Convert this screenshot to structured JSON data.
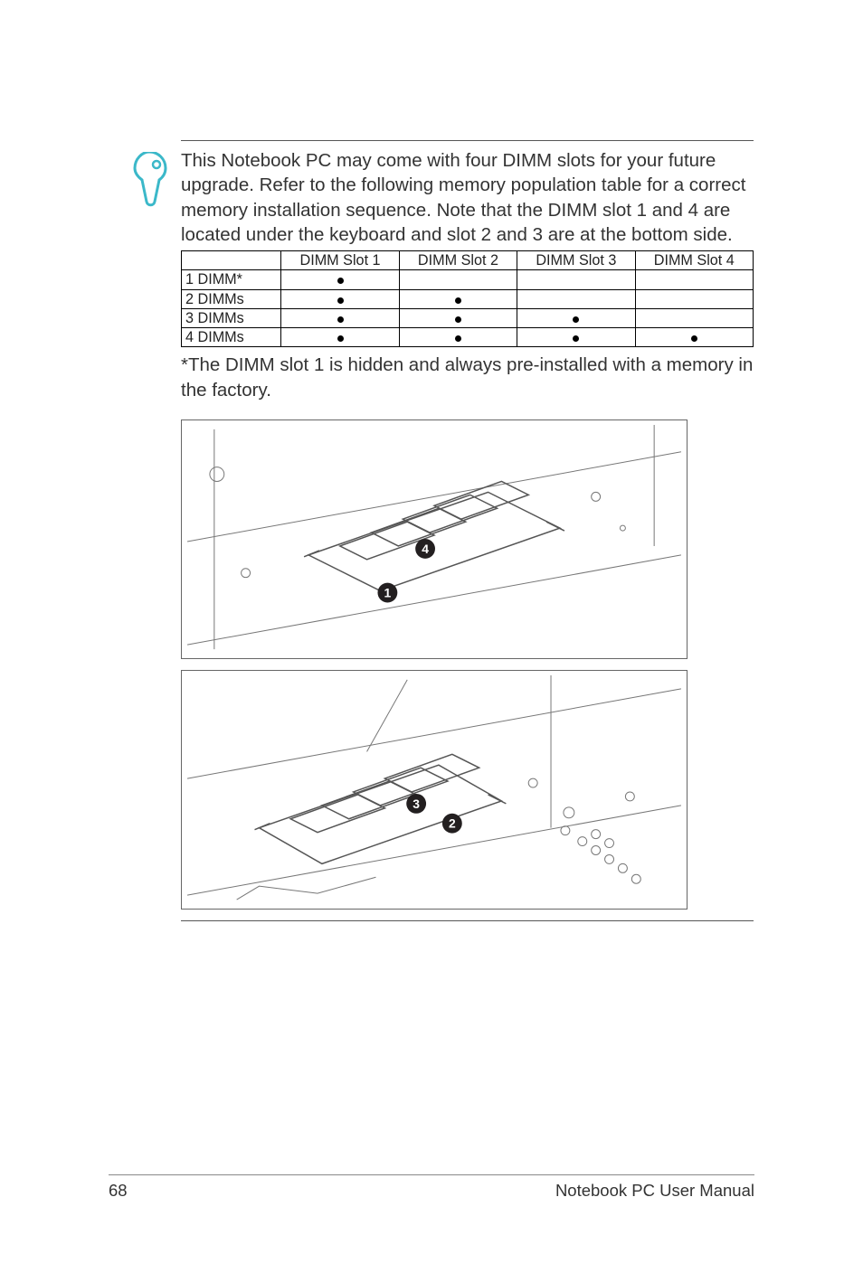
{
  "note": {
    "paragraph": "This Notebook PC may come with four DIMM slots for your future upgrade. Refer to the following memory population table for a correct memory installation sequence. Note that the DIMM slot 1 and 4 are located under the keyboard and slot 2 and 3 are at the bottom side."
  },
  "table": {
    "headers": [
      "",
      "DIMM Slot 1",
      "DIMM Slot 2",
      "DIMM Slot 3",
      "DIMM Slot 4"
    ],
    "rows": [
      {
        "label": "1 DIMM*",
        "cells": [
          true,
          false,
          false,
          false
        ]
      },
      {
        "label": "2 DIMMs",
        "cells": [
          true,
          true,
          false,
          false
        ]
      },
      {
        "label": "3 DIMMs",
        "cells": [
          true,
          true,
          true,
          false
        ]
      },
      {
        "label": "4 DIMMs",
        "cells": [
          true,
          true,
          true,
          true
        ]
      }
    ]
  },
  "footnote": "*The DIMM slot 1 is hidden and always pre-installed with a memory in the factory.",
  "illustrations": {
    "top_callouts": [
      "4",
      "1"
    ],
    "bottom_callouts": [
      "3",
      "2"
    ]
  },
  "footer": {
    "page_number": "68",
    "title": "Notebook PC User Manual"
  }
}
